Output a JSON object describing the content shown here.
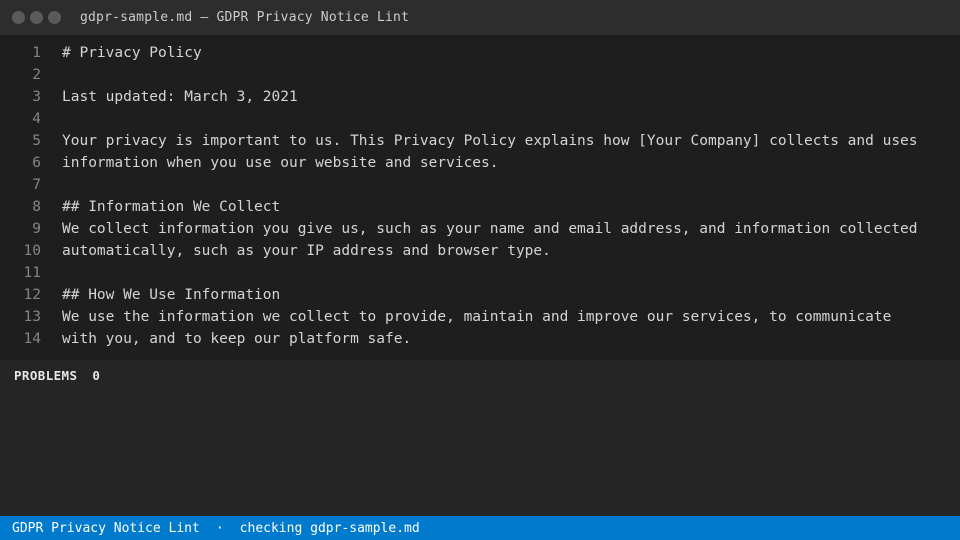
{
  "window": {
    "title": "gdpr-sample.md — GDPR Privacy Notice Lint",
    "traffic_lights": [
      "close-dot",
      "minimize-dot",
      "maximize-dot"
    ]
  },
  "editor": {
    "lines": [
      {
        "number": "1",
        "text": "# Privacy Policy"
      },
      {
        "number": "2",
        "text": ""
      },
      {
        "number": "3",
        "text": "Last updated: March 3, 2021"
      },
      {
        "number": "4",
        "text": ""
      },
      {
        "number": "5",
        "text": "Your privacy is important to us. This Privacy Policy explains how [Your Company] collects and uses"
      },
      {
        "number": "6",
        "text": "information when you use our website and services."
      },
      {
        "number": "7",
        "text": ""
      },
      {
        "number": "8",
        "text": "## Information We Collect"
      },
      {
        "number": "9",
        "text": "We collect information you give us, such as your name and email address, and information collected"
      },
      {
        "number": "10",
        "text": "automatically, such as your IP address and browser type."
      },
      {
        "number": "11",
        "text": ""
      },
      {
        "number": "12",
        "text": "## How We Use Information"
      },
      {
        "number": "13",
        "text": "We use the information we collect to provide, maintain and improve our services, to communicate"
      },
      {
        "number": "14",
        "text": "with you, and to keep our platform safe."
      }
    ]
  },
  "problems": {
    "label": "PROBLEMS",
    "count": "0"
  },
  "statusbar": {
    "app_name": "GDPR Privacy Notice Lint",
    "separator": "·",
    "status_text": "checking gdpr-sample.md"
  },
  "colors": {
    "titlebar": "#2d2d2d",
    "editor_bg": "#1e1e1e",
    "panel_bg": "#252526",
    "statusbar": "#007acc",
    "line_number": "#858585",
    "text": "#d4d4d4"
  }
}
